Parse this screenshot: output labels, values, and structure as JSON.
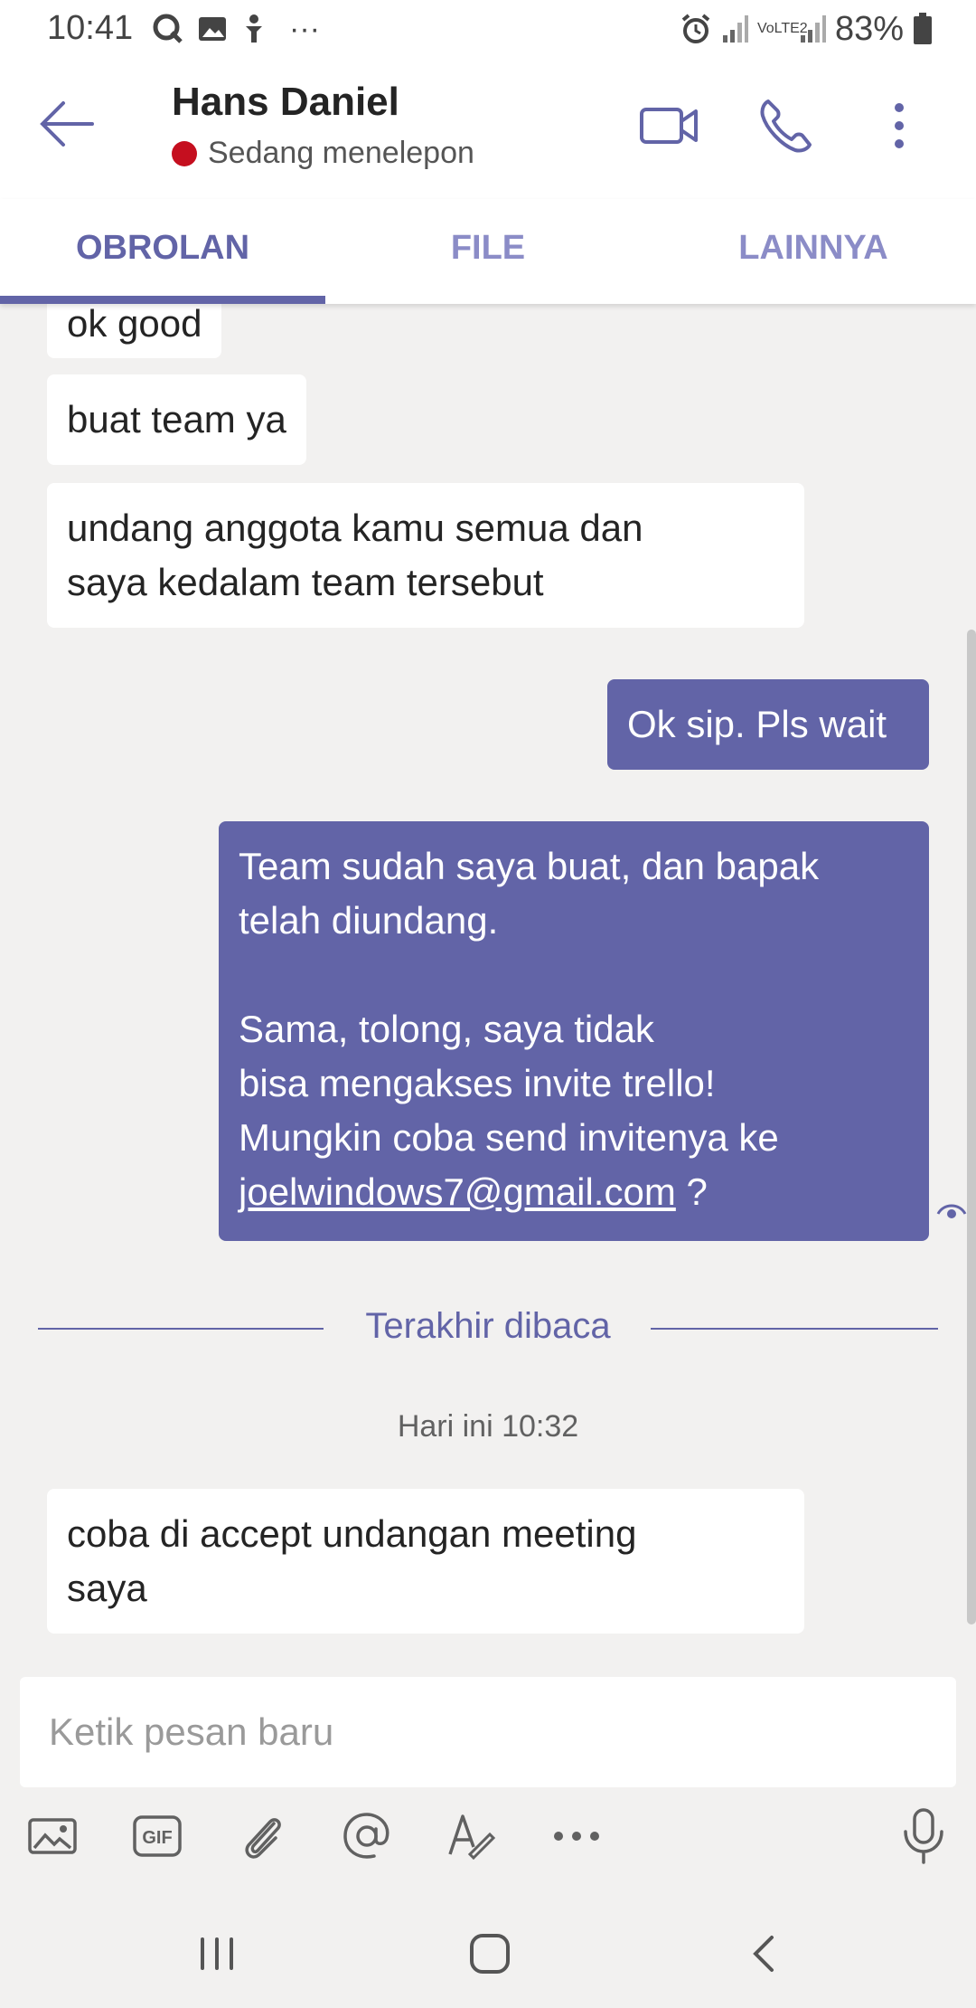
{
  "status": {
    "time": "10:41",
    "notif_more": "···",
    "network": "VoLTE2",
    "battery": "83%"
  },
  "header": {
    "title": "Hans Daniel",
    "presence": "Sedang menelepon",
    "presence_color": "#c50f1f"
  },
  "tabs": [
    {
      "label": "OBROLAN",
      "active": true
    },
    {
      "label": "FILE",
      "active": false
    },
    {
      "label": "LAINNYA",
      "active": false
    }
  ],
  "messages": [
    {
      "side": "in",
      "text": "ok good"
    },
    {
      "side": "in",
      "text": "buat team ya"
    },
    {
      "side": "in",
      "text": "undang anggota kamu semua dan\nsaya kedalam team tersebut"
    },
    {
      "side": "out",
      "text": "Ok sip. Pls wait"
    },
    {
      "side": "out",
      "text": "Team sudah saya buat, dan bapak\ntelah diundang.\n\nSama, tolong, saya tidak\nbisa mengakses invite trello!\nMungkin coba send invitenya ke\n",
      "link": "joelwindows7@gmail.com",
      "suffix": " ?"
    },
    {
      "side": "in",
      "text": "coba di accept undangan meeting\nsaya"
    }
  ],
  "divider_label": "Terakhir dibaca",
  "timestamp": "Hari ini 10:32",
  "compose": {
    "placeholder": "Ketik pesan baru"
  },
  "toolbar_icons": [
    "image-icon",
    "gif-icon",
    "attach-icon",
    "mention-icon",
    "format-icon",
    "more-icon",
    "mic-icon"
  ],
  "toolbar_gif_label": "GIF",
  "colors": {
    "brand": "#6264a7",
    "bubble_in": "#ffffff",
    "background": "#f2f1f0"
  }
}
